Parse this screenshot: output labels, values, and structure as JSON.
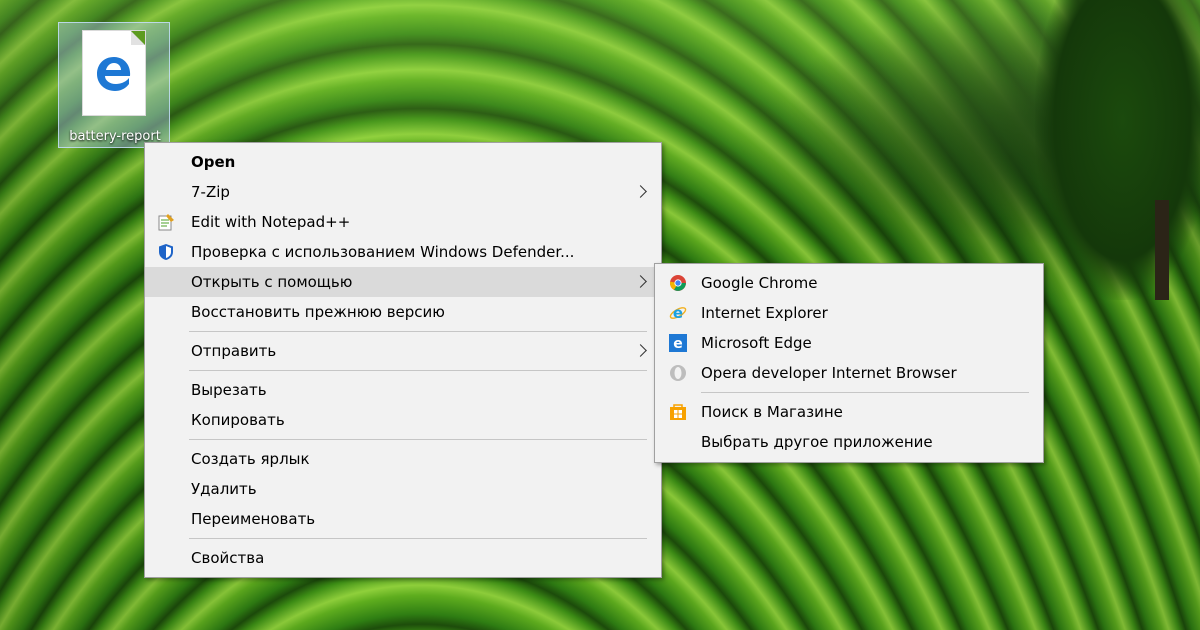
{
  "desktop": {
    "file_label": "battery-report"
  },
  "context_menu": {
    "items": [
      {
        "label": "Open"
      },
      {
        "label": "7-Zip"
      },
      {
        "label": "Edit with Notepad++"
      },
      {
        "label": "Проверка с использованием Windows Defender..."
      },
      {
        "label": "Открыть с помощью"
      },
      {
        "label": "Восстановить прежнюю версию"
      },
      {
        "label": "Отправить"
      },
      {
        "label": "Вырезать"
      },
      {
        "label": "Копировать"
      },
      {
        "label": "Создать ярлык"
      },
      {
        "label": "Удалить"
      },
      {
        "label": "Переименовать"
      },
      {
        "label": "Свойства"
      }
    ]
  },
  "open_with_menu": {
    "items": [
      {
        "label": "Google Chrome"
      },
      {
        "label": "Internet Explorer"
      },
      {
        "label": "Microsoft Edge"
      },
      {
        "label": "Opera developer Internet Browser"
      },
      {
        "label": "Поиск в Магазине"
      },
      {
        "label": "Выбрать другое приложение"
      }
    ]
  },
  "colors": {
    "menu_background": "#f2f2f2",
    "menu_hover": "#dadada",
    "edge_blue": "#1e78d4"
  }
}
